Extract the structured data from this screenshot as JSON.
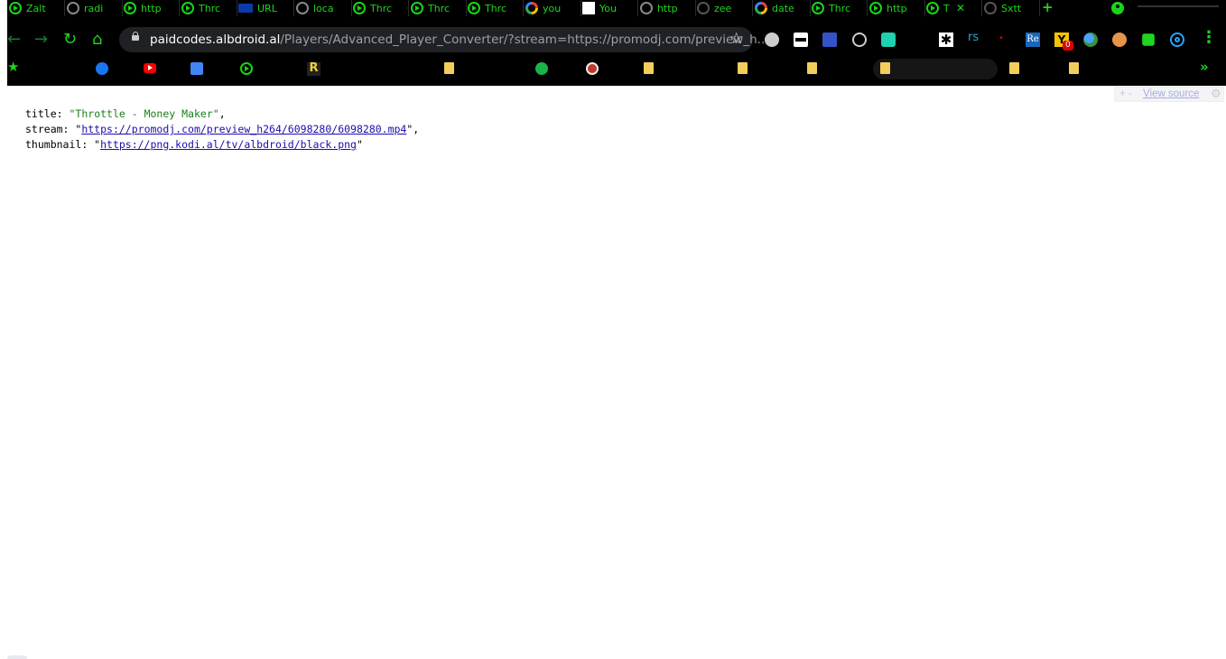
{
  "tabs": [
    {
      "icon": "play-icon",
      "title": "Zalt"
    },
    {
      "icon": "globe-icon",
      "title": "radi"
    },
    {
      "icon": "play-icon",
      "title": "http"
    },
    {
      "icon": "play-icon",
      "title": "Thrc"
    },
    {
      "icon": "tools-icon",
      "title": "URL"
    },
    {
      "icon": "globe-icon",
      "title": "loca"
    },
    {
      "icon": "play-icon",
      "title": "Thrc"
    },
    {
      "icon": "play-icon",
      "title": "Thrc"
    },
    {
      "icon": "play-icon",
      "title": "Thrc"
    },
    {
      "icon": "google-icon",
      "title": "you"
    },
    {
      "icon": "blank-icon",
      "title": "You"
    },
    {
      "icon": "globe-icon",
      "title": "http"
    },
    {
      "icon": "github-icon",
      "title": "zee"
    },
    {
      "icon": "google-icon",
      "title": "date"
    },
    {
      "icon": "play-icon",
      "title": "Thrc"
    },
    {
      "icon": "play-icon",
      "title": "http"
    },
    {
      "icon": "play-icon",
      "title": "T",
      "active": true,
      "close": "✕"
    },
    {
      "icon": "github-icon",
      "title": "Sxtt"
    }
  ],
  "toolbar": {
    "url_host": "paidcodes.albdroid.al",
    "url_rest": "/Players/Advanced_Player_Converter/?stream=https://promodj.com/preview_h...",
    "accent": "#1ed61e"
  },
  "extensions": [
    "globe-icon",
    "mask-icon",
    "mail-icon",
    "check-icon",
    "database-icon",
    "asterisk-icon",
    "rs-icon",
    "red-icon",
    "re-icon",
    "y-icon",
    "earth-icon",
    "code-icon",
    "puzzle-icon",
    "ring-icon"
  ],
  "ext_text": {
    "rs": "rs",
    "re": "Re",
    "y": "Y",
    "y_badge": "0",
    "asterisk": "✱",
    "red": "•"
  },
  "bookmarks": [
    "star-icon",
    "facebook-icon",
    "youtube-icon",
    "translate-icon",
    "play-icon",
    "r-icon",
    "note-icon",
    "globe-icon",
    "flag-icon",
    "note-icon",
    "note-icon",
    "note-icon",
    "note-icon",
    "note-icon",
    "note-icon"
  ],
  "bookmarks_more": "»",
  "r_letter": "R",
  "viewer": {
    "pm": "+ -",
    "view_source": "View source",
    "gear": "⚙"
  },
  "json": {
    "title_key": "title",
    "title_value": "Throttle - Money Maker",
    "stream_key": "stream",
    "stream_value": "https://promodj.com/preview_h264/6098280/6098280.mp4",
    "thumbnail_key": "thumbnail",
    "thumbnail_value": "https://png.kodi.al/tv/albdroid/black.png"
  }
}
